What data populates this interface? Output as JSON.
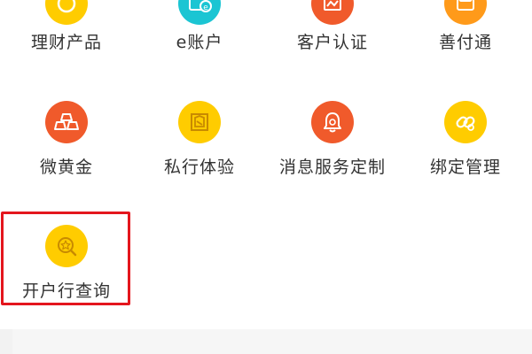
{
  "colors": {
    "yellow": "#ffcc00",
    "cyan": "#1bc5d3",
    "orange_red": "#f05a2b",
    "orange": "#ff9a1a",
    "highlight": "#e4161d",
    "label": "#333333"
  },
  "grid": {
    "row0": [
      {
        "label": "理财产品",
        "icon": "wealth-product-icon"
      },
      {
        "label": "e账户",
        "icon": "e-account-icon"
      },
      {
        "label": "客户认证",
        "icon": "customer-auth-icon"
      },
      {
        "label": "善付通",
        "icon": "shanfutong-icon"
      }
    ],
    "row1": [
      {
        "label": "微黄金",
        "icon": "gold-bars-icon"
      },
      {
        "label": "私行体验",
        "icon": "private-bank-icon"
      },
      {
        "label": "消息服务定制",
        "icon": "bell-icon"
      },
      {
        "label": "绑定管理",
        "icon": "link-icon"
      }
    ],
    "row2": [
      {
        "label": "开户行查询",
        "icon": "bank-search-icon"
      }
    ]
  }
}
